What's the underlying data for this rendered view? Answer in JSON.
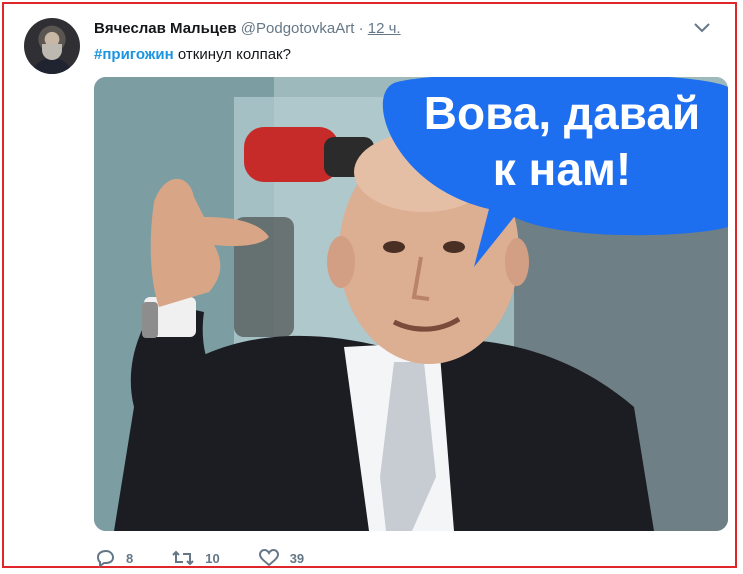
{
  "tweet": {
    "author_name": "Вячеслав Мальцев",
    "handle": "@PodgotovkaArt",
    "separator": "·",
    "time": "12 ч.",
    "hashtag": "#пригожин",
    "text": " откинул колпак?",
    "image": {
      "speech_line1": "Вова, давай",
      "speech_line2": "к нам!"
    },
    "actions": {
      "replies": "8",
      "retweets": "10",
      "likes": "39"
    }
  },
  "colors": {
    "frame_border": "#e0262b",
    "link": "#1b95e0",
    "bubble": "#1e6ef0",
    "muted": "#657786"
  },
  "icons": [
    "chevron-down-icon",
    "reply-icon",
    "retweet-icon",
    "like-icon"
  ]
}
